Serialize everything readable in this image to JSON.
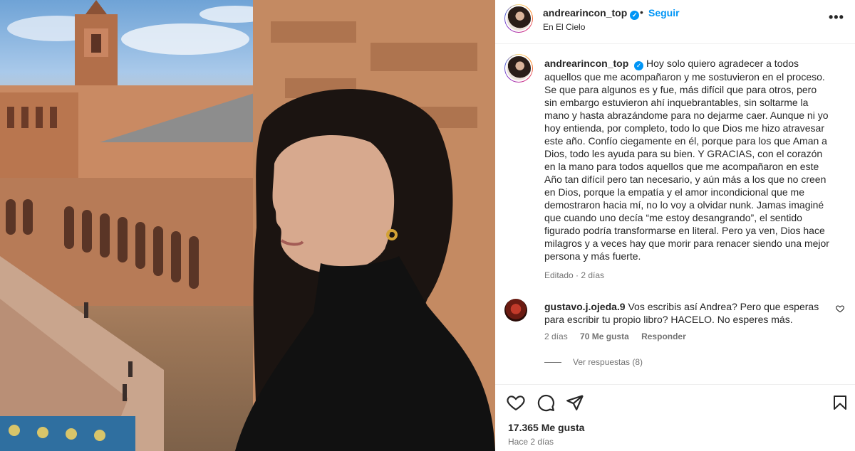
{
  "post": {
    "username": "andrearincon_top",
    "follow_label": "Seguir",
    "separator": "•",
    "location": "En El Cielo",
    "more_label": "•••"
  },
  "caption": {
    "username": "andrearincon_top",
    "text": "Hoy solo quiero agradecer a todos aquellos que me acompañaron y me sostuvieron en el proceso. Se que para algunos es y fue, más difícil que para otros, pero sin embargo estuvieron ahí inquebrantables, sin soltarme la mano y hasta abrazándome para no dejarme caer. Aunque ni yo hoy entienda, por completo, todo lo que Dios me hizo atravesar este año. Confío ciegamente en él, porque para los que Aman a Dios, todo les ayuda para su bien. Y GRACIAS, con el corazón en la mano para todos aquellos que me acompañaron en este Año tan difícil pero tan necesario, y aún más a los que no creen en Dios, porque la empatía y el amor incondicional que me demostraron hacia mí, no lo voy a olvidar nunk. Jamas imaginé que cuando uno decía “me estoy desangrando”, el sentido figurado podría transformarse en literal. Pero ya ven, Dios hace milagros y a veces hay que morir para renacer siendo una mejor persona y más fuerte.",
    "edited": "Editado · 2 días"
  },
  "comment": {
    "username": "gustavo.j.ojeda.9",
    "text": "Vos escribis así Andrea? Pero que esperas para escribir tu propio libro? HACELO. No esperes más.",
    "time": "2 días",
    "likes": "70 Me gusta",
    "reply_label": "Responder",
    "view_replies": "Ver respuestas (8)"
  },
  "footer": {
    "likes": "17.365 Me gusta",
    "posted_ago": "Hace 2 días"
  },
  "icons": {
    "verified": "verified-badge-icon",
    "like": "heart-icon",
    "comment": "comment-icon",
    "share": "paper-plane-icon",
    "save": "bookmark-icon",
    "comment_like": "small-heart-icon"
  },
  "colors": {
    "accent": "#0095f6",
    "text": "#262626",
    "secondary": "#737373"
  }
}
